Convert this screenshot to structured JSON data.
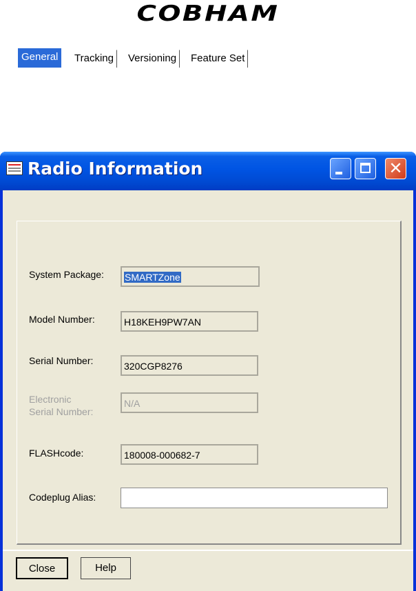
{
  "brand": {
    "logo_text": "COBHAM"
  },
  "window": {
    "title": "Radio Information",
    "icon": "document-icon",
    "controls": [
      "minimize-icon",
      "maximize-icon",
      "close-icon"
    ],
    "close_glyph": "✕"
  },
  "tabs": [
    {
      "label": "General",
      "active": true
    },
    {
      "label": "Tracking",
      "active": false
    },
    {
      "label": "Versioning",
      "active": false
    },
    {
      "label": "Feature Set",
      "active": false
    }
  ],
  "fields": {
    "system_package": {
      "label": "System Package:",
      "value": "SMARTZone"
    },
    "model_number": {
      "label": "Model Number:",
      "value": "H18KEH9PW7AN"
    },
    "serial_number": {
      "label": "Serial Number:",
      "value": "320CGP8276"
    },
    "esn": {
      "label_line1": "Electronic",
      "label_line2": "Serial Number:",
      "value": "N/A",
      "disabled": true
    },
    "flashcode": {
      "label": "FLASHcode:",
      "value": "180008-000682-7"
    },
    "codeplug_alias": {
      "label": "Codeplug Alias:",
      "value": ""
    }
  },
  "buttons": {
    "close": "Close",
    "help": "Help"
  },
  "colors": {
    "title_bar": "#0054e3",
    "active_tab": "#2a6ad8",
    "dialog_bg": "#ece9d8"
  }
}
